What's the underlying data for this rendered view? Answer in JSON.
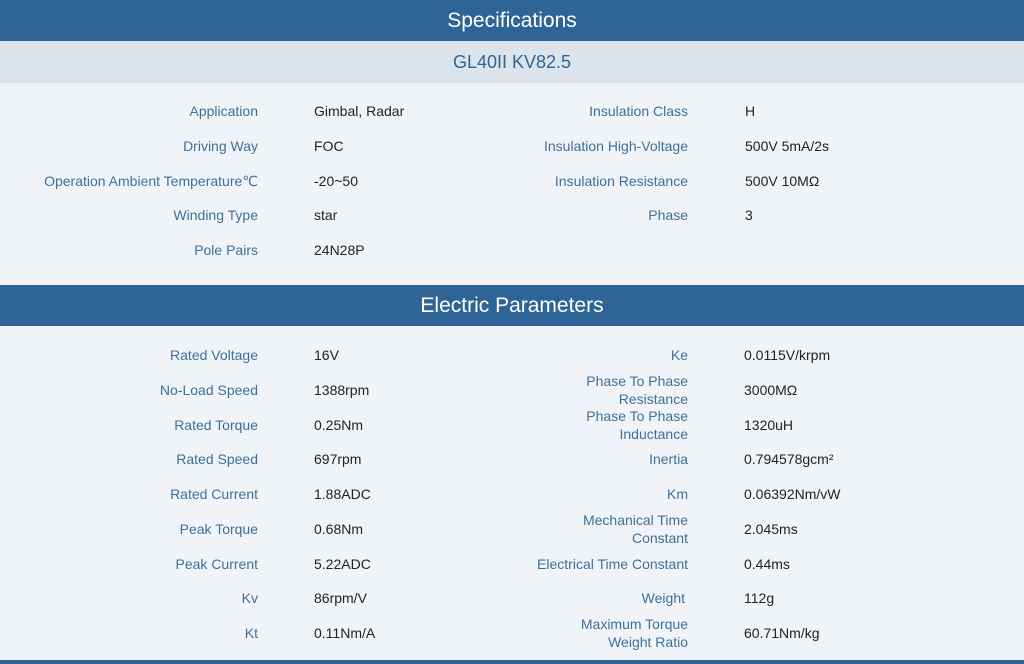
{
  "specifications": {
    "title": "Specifications",
    "model": "GL40II KV82.5",
    "left": [
      {
        "label": "Application",
        "value": "Gimbal, Radar"
      },
      {
        "label": "Driving Way",
        "value": "FOC"
      },
      {
        "label": "Operation Ambient Temperature℃",
        "value": "-20~50"
      },
      {
        "label": "Winding Type",
        "value": "star"
      },
      {
        "label": "Pole Pairs",
        "value": "24N28P"
      }
    ],
    "right": [
      {
        "label": "Insulation Class",
        "value": "H"
      },
      {
        "label": "Insulation High-Voltage",
        "value": "500V 5mA/2s"
      },
      {
        "label": "Insulation Resistance",
        "value": "500V 10MΩ"
      },
      {
        "label": "Phase",
        "value": "3"
      }
    ]
  },
  "electric": {
    "title": "Electric Parameters",
    "left": [
      {
        "label": "Rated Voltage",
        "value": "16V"
      },
      {
        "label": "No-Load Speed",
        "value": "1388rpm"
      },
      {
        "label": "Rated Torque",
        "value": "0.25Nm"
      },
      {
        "label": "Rated Speed",
        "value": "697rpm"
      },
      {
        "label": "Rated Current",
        "value": "1.88ADC"
      },
      {
        "label": "Peak Torque",
        "value": "0.68Nm"
      },
      {
        "label": "Peak Current",
        "value": "5.22ADC"
      },
      {
        "label": "Kv",
        "value": "86rpm/V"
      },
      {
        "label": "Kt",
        "value": "0.11Nm/A"
      }
    ],
    "right": [
      {
        "label": "Ke",
        "value": "0.0115V/krpm"
      },
      {
        "label": "Phase To Phase Resistance",
        "value": "3000MΩ"
      },
      {
        "label": "Phase To Phase Inductance",
        "value": "1320uH"
      },
      {
        "label": "Inertia",
        "value": "0.794578gcm²"
      },
      {
        "label": "Km",
        "value": "0.06392Nm/vW"
      },
      {
        "label": "Mechanical Time Constant",
        "value": "2.045ms"
      },
      {
        "label": "Electrical Time Constant",
        "value": "0.44ms"
      },
      {
        "label": "Weight",
        "value": "112g"
      },
      {
        "label": "Maximum Torque Weight Ratio",
        "value": "60.71Nm/kg"
      }
    ]
  }
}
